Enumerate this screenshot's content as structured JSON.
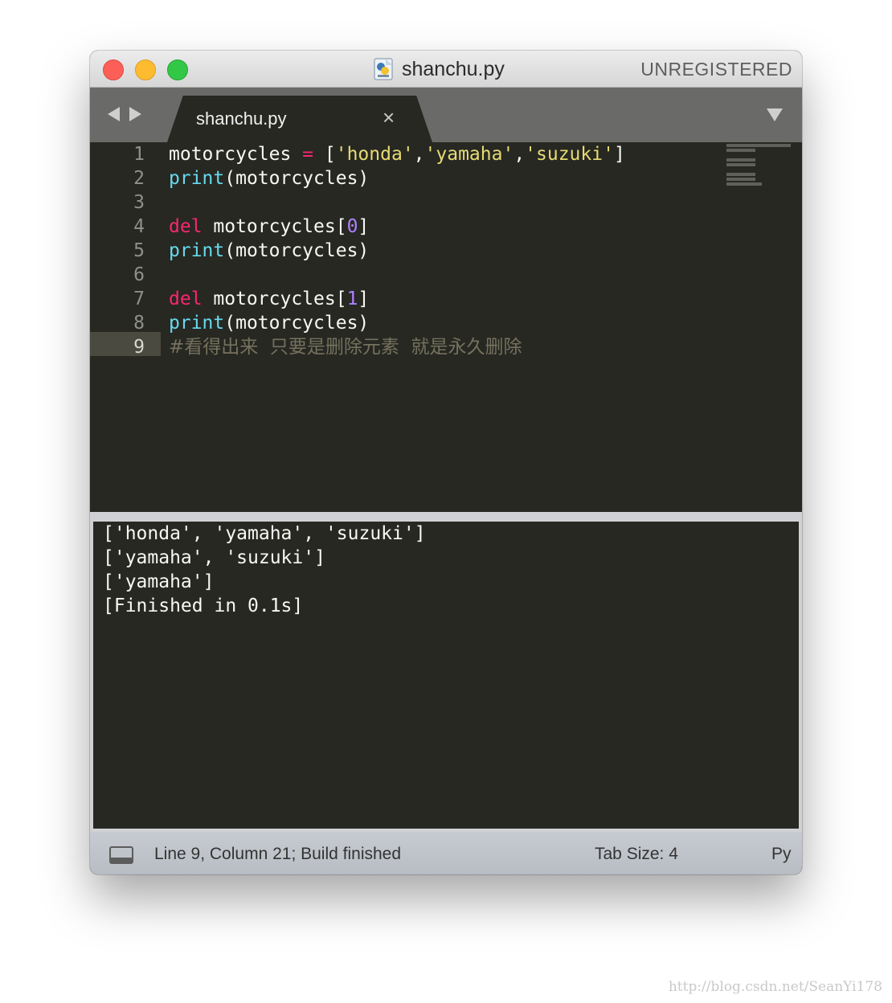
{
  "titlebar": {
    "title": "shanchu.py",
    "unregistered": "UNREGISTERED"
  },
  "tab": {
    "label": "shanchu.py",
    "close_glyph": "×"
  },
  "editor": {
    "line_numbers": [
      "1",
      "2",
      "3",
      "4",
      "5",
      "6",
      "7",
      "8",
      "9"
    ],
    "active_line": 9,
    "lines": [
      [
        [
          "motorcycles ",
          "plain"
        ],
        [
          "=",
          "op"
        ],
        [
          " [",
          "plain"
        ],
        [
          "'honda'",
          "str"
        ],
        [
          ",",
          "plain"
        ],
        [
          "'yamaha'",
          "str"
        ],
        [
          ",",
          "plain"
        ],
        [
          "'suzuki'",
          "str"
        ],
        [
          "]",
          "plain"
        ]
      ],
      [
        [
          "print",
          "fn"
        ],
        [
          "(motorcycles)",
          "plain"
        ]
      ],
      [],
      [
        [
          "del",
          "kw"
        ],
        [
          " motorcycles[",
          "plain"
        ],
        [
          "0",
          "num"
        ],
        [
          "]",
          "plain"
        ]
      ],
      [
        [
          "print",
          "fn"
        ],
        [
          "(motorcycles)",
          "plain"
        ]
      ],
      [],
      [
        [
          "del",
          "kw"
        ],
        [
          " motorcycles[",
          "plain"
        ],
        [
          "1",
          "num"
        ],
        [
          "]",
          "plain"
        ]
      ],
      [
        [
          "print",
          "fn"
        ],
        [
          "(motorcycles)",
          "plain"
        ]
      ],
      [
        [
          "#看得出来  只要是删除元素  就是永久删除",
          "cm"
        ]
      ]
    ]
  },
  "output": {
    "lines": [
      "['honda', 'yamaha', 'suzuki']",
      "['yamaha', 'suzuki']",
      "['yamaha']",
      "[Finished in 0.1s]"
    ]
  },
  "statusbar": {
    "position": "Line 9, Column 21; Build finished",
    "tab_size": "Tab Size: 4",
    "syntax": "Py"
  },
  "watermark": "http://blog.csdn.net/SeanYi178",
  "icons": [
    "close-window",
    "minimize-window",
    "zoom-window",
    "python-file-icon",
    "back-arrow-icon",
    "forward-arrow-icon",
    "tab-close-icon",
    "tab-dropdown-icon",
    "panel-toggle-icon"
  ],
  "colors": {
    "background": "#272822",
    "keyword": "#f92672",
    "function": "#66d9ef",
    "string": "#e6db74",
    "number": "#ae81ff",
    "comment": "#75715e",
    "text": "#f8f8f2"
  }
}
